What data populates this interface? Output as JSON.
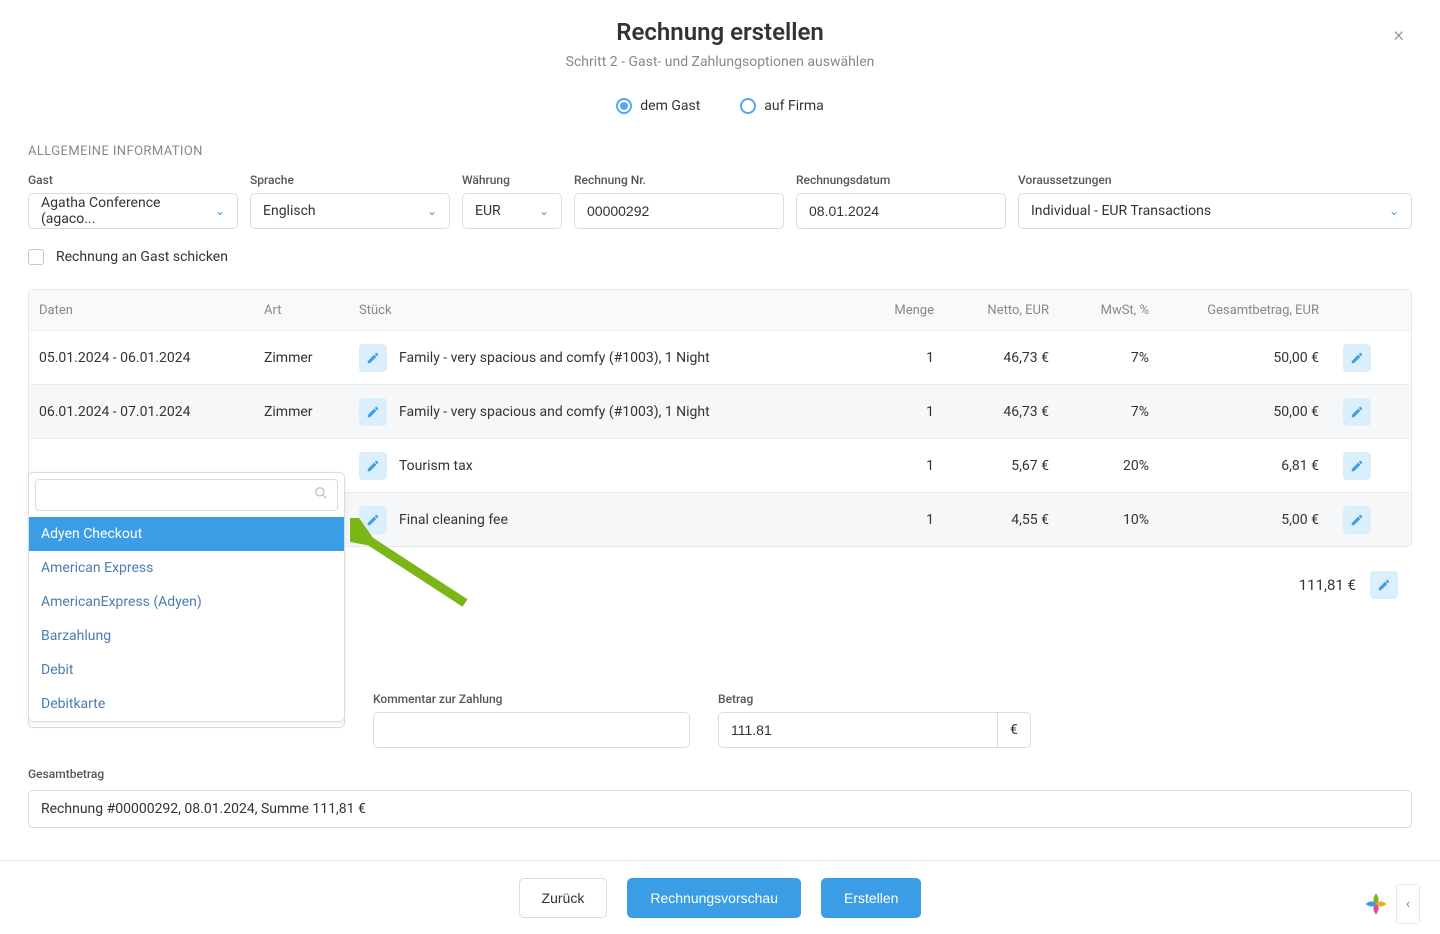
{
  "header": {
    "title": "Rechnung erstellen",
    "subtitle": "Schritt 2 - Gast- und Zahlungsoptionen auswählen"
  },
  "recipient": {
    "guest_label": "dem Gast",
    "company_label": "auf Firma"
  },
  "section_general": "ALLGEMEINE INFORMATION",
  "form": {
    "guest_label": "Gast",
    "guest_value": "Agatha Conference (agaco...",
    "language_label": "Sprache",
    "language_value": "Englisch",
    "currency_label": "Währung",
    "currency_value": "EUR",
    "invoice_no_label": "Rechnung Nr.",
    "invoice_no_value": "00000292",
    "invoice_date_label": "Rechnungsdatum",
    "invoice_date_value": "08.01.2024",
    "prereq_label": "Voraussetzungen",
    "prereq_value": "Individual - EUR Transactions",
    "send_to_guest_label": "Rechnung an Gast schicken"
  },
  "table": {
    "headers": {
      "dates": "Daten",
      "type": "Art",
      "item": "Stück",
      "qty": "Menge",
      "net": "Netto, EUR",
      "vat": "MwSt, %",
      "total": "Gesamtbetrag, EUR"
    },
    "rows": [
      {
        "dates": "05.01.2024 - 06.01.2024",
        "type": "Zimmer",
        "item": "Family - very spacious and comfy  (#1003), 1 Night",
        "qty": "1",
        "net": "46,73 €",
        "vat": "7%",
        "total": "50,00 €"
      },
      {
        "dates": "06.01.2024 - 07.01.2024",
        "type": "Zimmer",
        "item": "Family - very spacious and comfy  (#1003), 1 Night",
        "qty": "1",
        "net": "46,73 €",
        "vat": "7%",
        "total": "50,00 €"
      },
      {
        "dates": "",
        "type": "",
        "item": "Tourism tax",
        "qty": "1",
        "net": "5,67 €",
        "vat": "20%",
        "total": "6,81 €"
      },
      {
        "dates": "",
        "type": "",
        "item": "Final cleaning fee",
        "qty": "1",
        "net": "4,55 €",
        "vat": "10%",
        "total": "5,00 €"
      }
    ]
  },
  "grand_total": "111,81 €",
  "dropdown": {
    "search_value": "",
    "items": [
      "Adyen Checkout",
      "American Express",
      "AmericanExpress (Adyen)",
      "Barzahlung",
      "Debit",
      "Debitkarte"
    ]
  },
  "payment": {
    "selected_method": "Adyen Checkout",
    "comment_label": "Kommentar zur Zahlung",
    "comment_value": "",
    "amount_label": "Betrag",
    "amount_value": "111.81",
    "amount_unit": "€"
  },
  "summary": {
    "label": "Gesamtbetrag",
    "text": "Rechnung #00000292, 08.01.2024, Summe 111,81 €"
  },
  "footer": {
    "back": "Zurück",
    "preview": "Rechnungsvorschau",
    "create": "Erstellen"
  }
}
